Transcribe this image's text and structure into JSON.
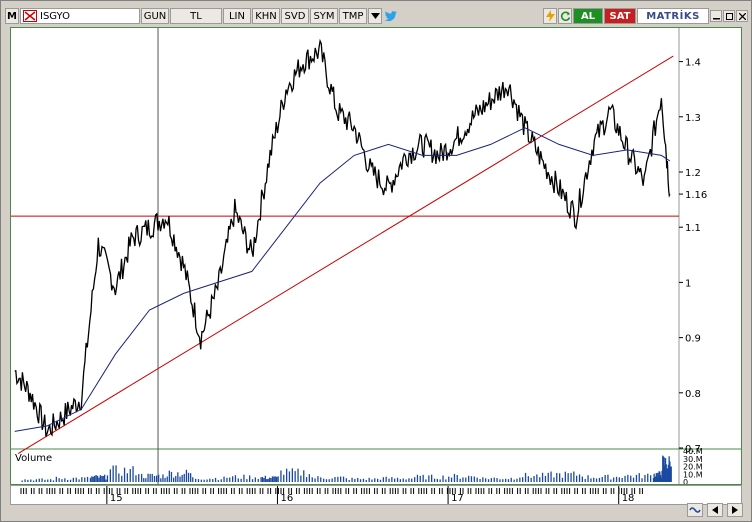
{
  "toolbar": {
    "menu_label": "M",
    "symbol": "ISGYO",
    "buttons": [
      "GUN",
      "TL",
      "LIN",
      "KHN",
      "SVD",
      "SYM",
      "TMP"
    ],
    "dropdown_icon": "triangle-down",
    "twitter_icon": "twitter-bird",
    "flash_icon": "lightning-bolt",
    "refresh_icon": "refresh",
    "buy_label": "AL",
    "sell_label": "SAT",
    "brand": "MATRİKS",
    "window_controls": [
      "min",
      "max",
      "close"
    ]
  },
  "price_axis": {
    "ticks": [
      "1.4",
      "1.3",
      "1.2",
      "1.16",
      "1.1",
      "1",
      "0.9",
      "0.8",
      "0.7"
    ],
    "current": "1.16"
  },
  "volume_panel": {
    "label": "Volume",
    "ticks": [
      "40.M",
      "30.M",
      "20.M",
      "10.M",
      "0"
    ]
  },
  "time_axis": {
    "labels": [
      "15",
      "16",
      "17",
      "18"
    ]
  },
  "colors": {
    "price": "#000000",
    "moving_average": "#1a237e",
    "trendline": "#cc0000",
    "volume": "#1a4aa0",
    "frame": "#4a8a4a"
  },
  "chart_data": {
    "type": "line",
    "series": [
      {
        "x": [
          2014.46,
          2014.55,
          2014.65,
          2014.75,
          2014.85,
          2014.95,
          2015.05,
          2015.15,
          2015.25,
          2015.35,
          2015.45,
          2015.55,
          2015.65,
          2015.75,
          2015.85,
          2015.95,
          2016.05,
          2016.15,
          2016.25,
          2016.35,
          2016.45,
          2016.55,
          2016.65,
          2016.75,
          2016.85,
          2016.95,
          2017.05,
          2017.15,
          2017.25,
          2017.35,
          2017.45,
          2017.55,
          2017.65,
          2017.75,
          2017.85,
          2017.95,
          2018.05,
          2018.15,
          2018.25,
          2018.3
        ],
        "values": [
          0.84,
          0.8,
          0.73,
          0.76,
          0.79,
          1.07,
          0.99,
          1.08,
          1.1,
          1.12,
          1.03,
          0.9,
          0.99,
          1.13,
          1.05,
          1.22,
          1.35,
          1.4,
          1.42,
          1.31,
          1.28,
          1.2,
          1.17,
          1.23,
          1.25,
          1.23,
          1.26,
          1.3,
          1.33,
          1.36,
          1.28,
          1.22,
          1.17,
          1.12,
          1.25,
          1.31,
          1.24,
          1.18,
          1.34,
          1.16
        ]
      },
      {
        "x": [
          2014.46,
          2014.65,
          2014.85,
          2015.05,
          2015.25,
          2015.45,
          2015.65,
          2015.85,
          2016.05,
          2016.25,
          2016.45,
          2016.65,
          2016.85,
          2017.05,
          2017.25,
          2017.45,
          2017.65,
          2017.85,
          2018.05,
          2018.25,
          2018.3
        ],
        "values": [
          0.73,
          0.74,
          0.77,
          0.87,
          0.95,
          0.98,
          1.0,
          1.02,
          1.1,
          1.18,
          1.23,
          1.25,
          1.23,
          1.23,
          1.25,
          1.28,
          1.25,
          1.23,
          1.24,
          1.23,
          1.22
        ]
      }
    ],
    "ylim": [
      0.7,
      1.45
    ],
    "xlim": [
      2014.45,
      2018.33
    ],
    "trendline": {
      "x": [
        2014.48,
        2018.32
      ],
      "values": [
        0.69,
        1.41
      ]
    },
    "horizontal_line": 1.12,
    "vertical_line": 2015.3,
    "volume": {
      "ylim": [
        0,
        40
      ],
      "x": [
        2014.5,
        2014.7,
        2014.9,
        2015.0,
        2015.2,
        2015.35,
        2015.5,
        2015.7,
        2015.9,
        2016.0,
        2016.2,
        2016.4,
        2016.6,
        2016.8,
        2017.0,
        2017.2,
        2017.4,
        2017.6,
        2017.8,
        2018.0,
        2018.2,
        2018.25,
        2018.3
      ],
      "values": [
        4,
        6,
        8,
        18,
        10,
        14,
        6,
        8,
        7,
        15,
        7,
        5,
        6,
        8,
        9,
        6,
        10,
        12,
        8,
        10,
        12,
        30,
        20
      ]
    }
  }
}
